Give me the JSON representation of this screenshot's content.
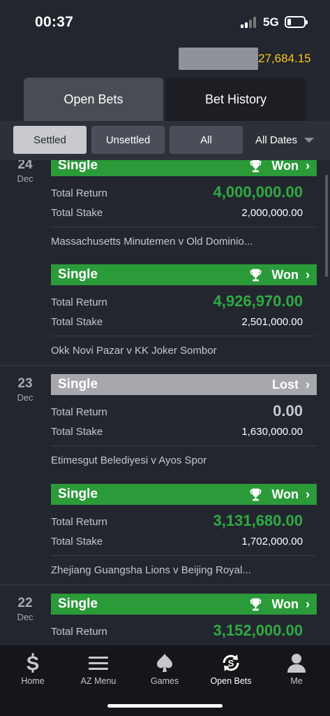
{
  "status_bar": {
    "time": "00:37",
    "network": "5G"
  },
  "balance": {
    "amount": "27,684.15"
  },
  "tabs": [
    {
      "label": "Open Bets"
    },
    {
      "label": "Bet History"
    }
  ],
  "filters": {
    "settled": "Settled",
    "unsettled": "Unsettled",
    "all": "All",
    "dates": "All Dates"
  },
  "days": [
    {
      "day": "24",
      "month": "Dec"
    },
    {
      "day": "23",
      "month": "Dec"
    },
    {
      "day": "22",
      "month": "Dec"
    }
  ],
  "bets": [
    {
      "type": "Single",
      "status": "Won",
      "total_return_label": "Total Return",
      "total_return": "4,000,000.00",
      "total_stake_label": "Total Stake",
      "total_stake": "2,000,000.00",
      "event": "Massachusetts Minutemen v Old Dominio..."
    },
    {
      "type": "Single",
      "status": "Won",
      "total_return_label": "Total Return",
      "total_return": "4,926,970.00",
      "total_stake_label": "Total Stake",
      "total_stake": "2,501,000.00",
      "event": "Okk Novi Pazar v KK Joker Sombor"
    },
    {
      "type": "Single",
      "status": "Lost",
      "total_return_label": "Total Return",
      "total_return": "0.00",
      "total_stake_label": "Total Stake",
      "total_stake": "1,630,000.00",
      "event": "Etimesgut Belediyesi v Ayos Spor"
    },
    {
      "type": "Single",
      "status": "Won",
      "total_return_label": "Total Return",
      "total_return": "3,131,680.00",
      "total_stake_label": "Total Stake",
      "total_stake": "1,702,000.00",
      "event": "Zhejiang Guangsha Lions v Beijing Royal..."
    },
    {
      "type": "Single",
      "status": "Won",
      "total_return_label": "Total Return",
      "total_return": "3,152,000.00"
    }
  ],
  "nav": [
    {
      "label": "Home",
      "icon": "dollar-s-icon"
    },
    {
      "label": "AZ Menu",
      "icon": "hamburger-icon"
    },
    {
      "label": "Games",
      "icon": "spade-icon"
    },
    {
      "label": "Open Bets",
      "icon": "refresh-dollar-icon"
    },
    {
      "label": "Me",
      "icon": "user-icon"
    }
  ],
  "colors": {
    "won": "#2b9a39",
    "lost": "#a6a8ad",
    "balance": "#f7c81e",
    "accent_green_text": "#2fab42"
  }
}
